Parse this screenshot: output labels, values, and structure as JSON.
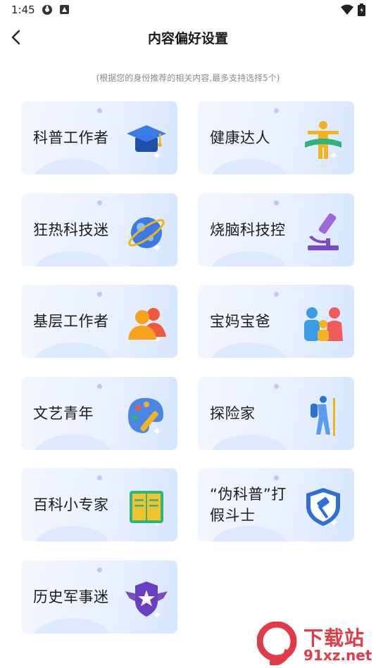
{
  "status_bar": {
    "time": "1:45"
  },
  "header": {
    "title": "内容偏好设置",
    "subtitle": "(根据您的身份推荐的相关内容,最多支持选择5个)"
  },
  "cards": [
    {
      "label": "科普工作者",
      "icon": "graduation-cap-icon"
    },
    {
      "label": "健康达人",
      "icon": "fitness-person-icon"
    },
    {
      "label": "狂热科技迷",
      "icon": "planet-icon"
    },
    {
      "label": "烧脑科技控",
      "icon": "microscope-icon"
    },
    {
      "label": "基层工作者",
      "icon": "people-group-icon"
    },
    {
      "label": "宝妈宝爸",
      "icon": "family-icon"
    },
    {
      "label": "文艺青年",
      "icon": "paint-palette-icon"
    },
    {
      "label": "探险家",
      "icon": "hiker-icon"
    },
    {
      "label": "百科小专家",
      "icon": "open-book-icon"
    },
    {
      "label": "“伪科普”打假斗士",
      "icon": "shield-gavel-icon"
    },
    {
      "label": "历史军事迷",
      "icon": "military-badge-icon"
    }
  ],
  "watermark": {
    "title": "下载站",
    "url": "91xz.net"
  },
  "colors": {
    "accent": "#3f78e0",
    "card_bg": "#eaf2ff",
    "watermark": "#e23b47"
  }
}
